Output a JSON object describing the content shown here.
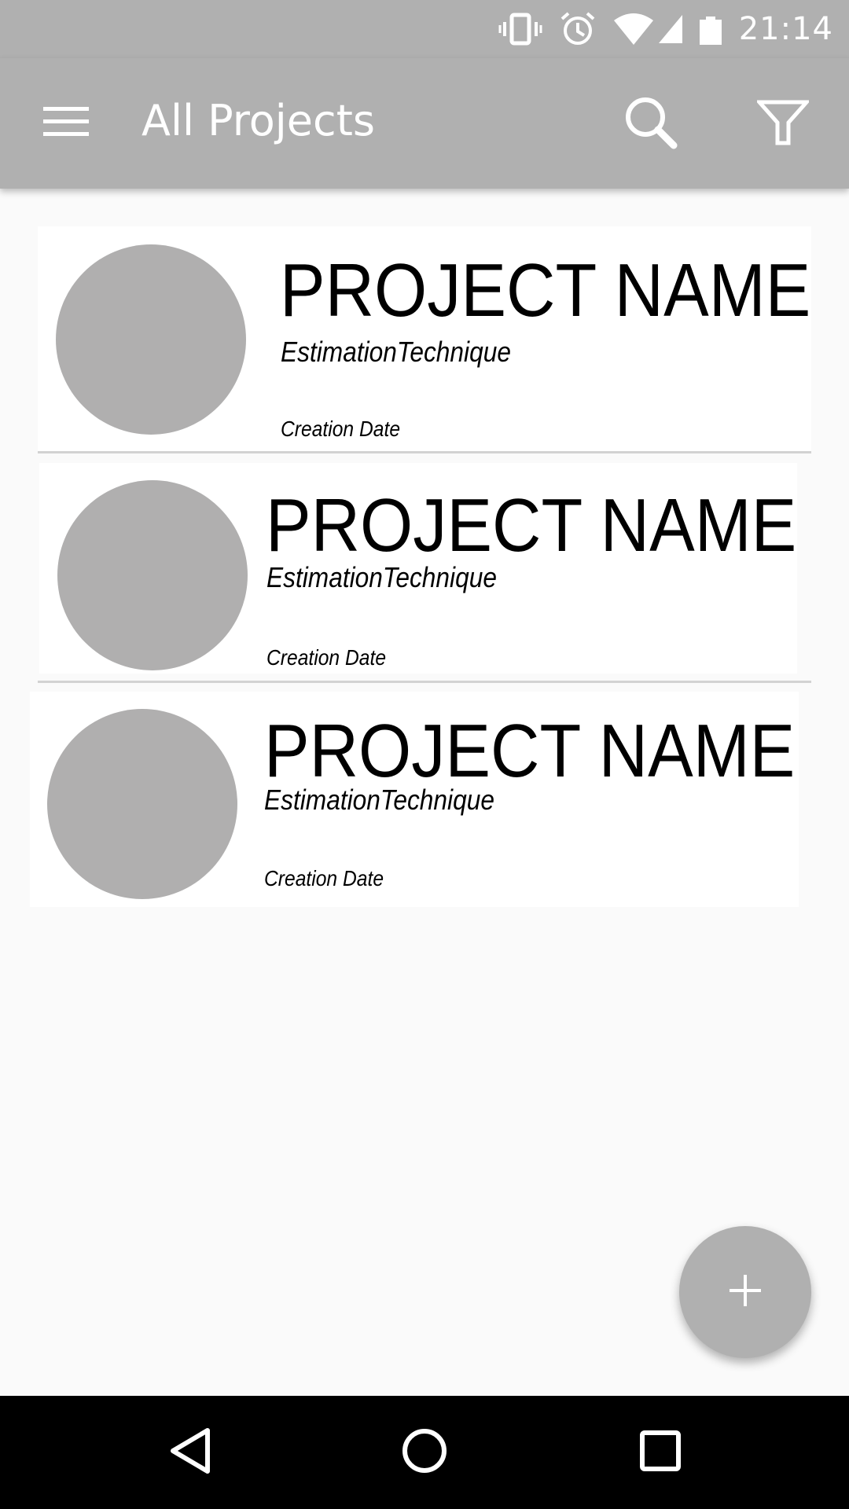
{
  "status_bar": {
    "time": "21:14",
    "icons": [
      "vibrate-icon",
      "alarm-icon",
      "wifi-icon",
      "signal-icon",
      "battery-icon"
    ]
  },
  "toolbar": {
    "title": "All Projects",
    "menu_icon": "menu-icon",
    "search_icon": "search-icon",
    "filter_icon": "filter-icon",
    "background_color": "#b0b0b0",
    "text_color": "#ffffff"
  },
  "projects": [
    {
      "name": "PROJECT NAME",
      "estimation_technique": "EstimationTechnique",
      "creation_date": "Creation Date"
    },
    {
      "name": "PROJECT NAME",
      "estimation_technique": "EstimationTechnique",
      "creation_date": "Creation Date"
    },
    {
      "name": "PROJECT NAME",
      "estimation_technique": "EstimationTechnique",
      "creation_date": "Creation Date"
    }
  ],
  "fab": {
    "icon": "plus-icon",
    "color": "#b0b0b0"
  },
  "nav_bar": {
    "icons": [
      "back-icon",
      "home-icon",
      "recents-icon"
    ]
  },
  "colors": {
    "avatar_placeholder": "#b0afaf",
    "page_background": "#fafafa",
    "card_background": "#ffffff"
  }
}
